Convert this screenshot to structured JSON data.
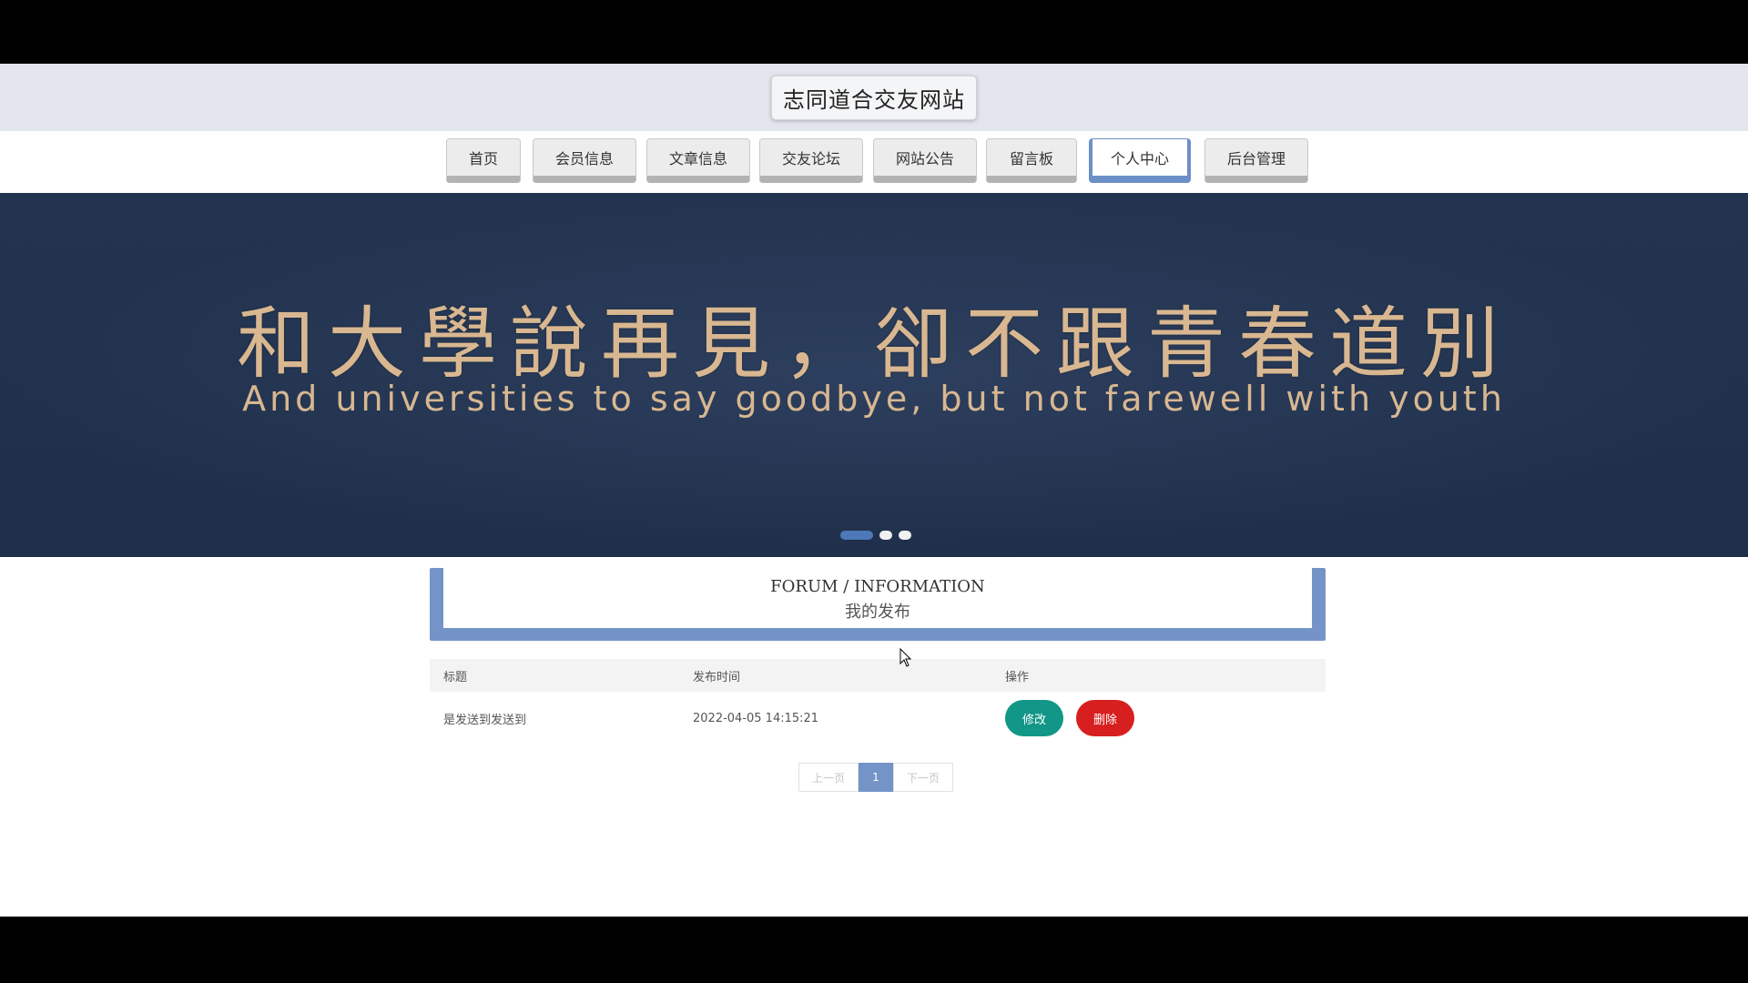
{
  "header": {
    "site_title": "志同道合交友网站"
  },
  "nav": {
    "items": [
      {
        "label": "首页"
      },
      {
        "label": "会员信息"
      },
      {
        "label": "文章信息"
      },
      {
        "label": "交友论坛"
      },
      {
        "label": "网站公告"
      },
      {
        "label": "留言板"
      },
      {
        "label": "个人中心",
        "active": true
      },
      {
        "label": "后台管理"
      }
    ]
  },
  "banner": {
    "title_cn": "和大學說再見，卻不跟青春道別",
    "title_en": "And universities to say goodbye, but not farewell with youth",
    "slides": 3,
    "active_slide": 1
  },
  "section": {
    "title_en": "FORUM / INFORMATION",
    "title_cn": "我的发布"
  },
  "table": {
    "headers": [
      "标题",
      "发布时间",
      "操作"
    ],
    "rows": [
      {
        "title": "是发送到发送到",
        "time": "2022-04-05 14:15:21",
        "edit": "修改",
        "delete": "删除"
      }
    ]
  },
  "pagination": {
    "prev": "上一页",
    "current": "1",
    "next": "下一页"
  },
  "colors": {
    "accent": "#7494c8",
    "edit": "#119687",
    "delete": "#d71f1f"
  }
}
